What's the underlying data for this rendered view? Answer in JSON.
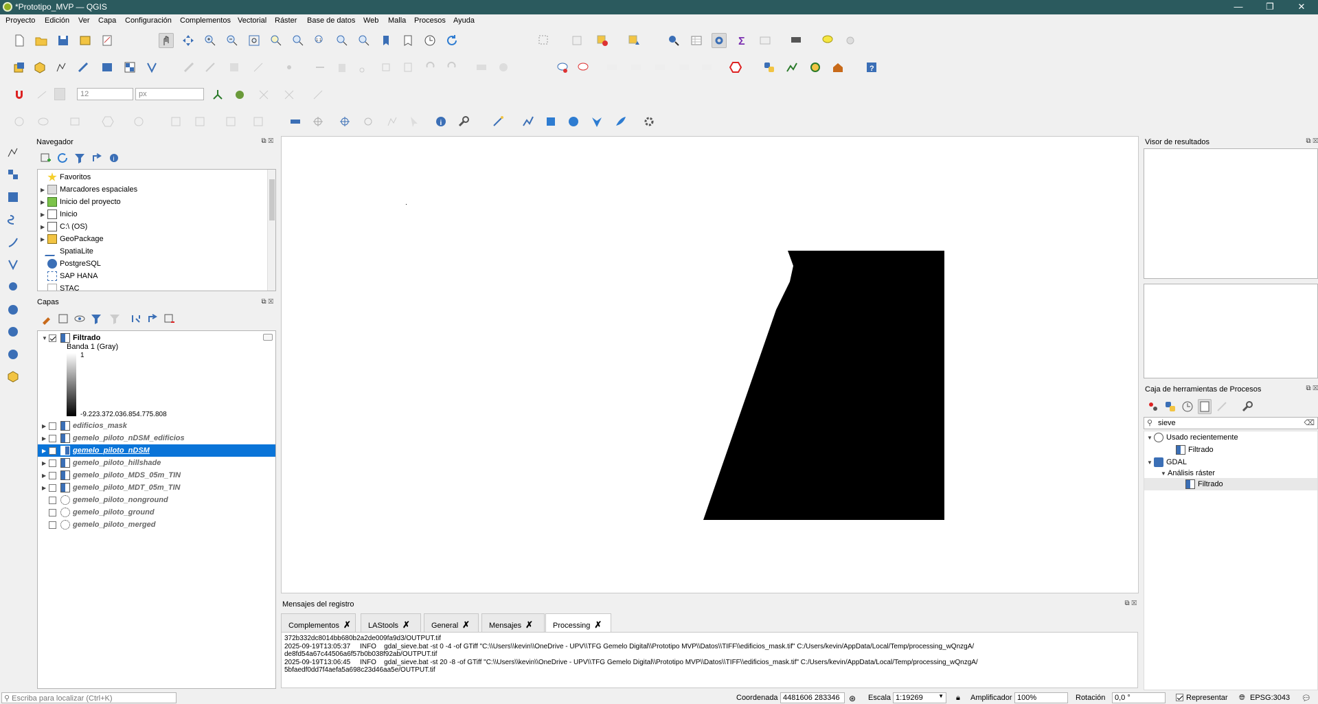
{
  "window": {
    "title": "*Prototipo_MVP — QGIS",
    "minimize": "—",
    "maximize": "❐",
    "close": "✕"
  },
  "menu": [
    "Proyecto",
    "Edición",
    "Ver",
    "Capa",
    "Configuración",
    "Complementos",
    "Vectorial",
    "Ráster",
    "Base de datos",
    "Web",
    "Malla",
    "Procesos",
    "Ayuda"
  ],
  "snapping": {
    "tolerance": "12",
    "unit": "px"
  },
  "browser": {
    "title": "Navegador",
    "items": [
      "Favoritos",
      "Marcadores espaciales",
      "Inicio del proyecto",
      "Inicio",
      "C:\\ (OS)",
      "GeoPackage",
      "SpatiaLite",
      "PostgreSQL",
      "SAP HANA",
      "STAC"
    ]
  },
  "layers": {
    "title": "Capas",
    "active": {
      "name": "Filtrado",
      "band": "Banda 1 (Gray)",
      "max": "1",
      "min": "-9.223.372.036.854.775.808"
    },
    "list": [
      "edificios_mask",
      "gemelo_piloto_nDSM_edificios",
      "gemelo_piloto_nDSM",
      "gemelo_piloto_hillshade",
      "gemelo_piloto_MDS_05m_TIN",
      "gemelo_piloto_MDT_05m_TIN",
      "gemelo_piloto_nonground",
      "gemelo_piloto_ground",
      "gemelo_piloto_merged"
    ],
    "selected": "gemelo_piloto_nDSM"
  },
  "results": {
    "title": "Visor de resultados"
  },
  "toolbox": {
    "title": "Caja de herramientas de Procesos",
    "search": "sieve",
    "recent_label": "Usado recientemente",
    "recent_item": "Filtrado",
    "provider": "GDAL",
    "group": "Análisis ráster",
    "algo": "Filtrado"
  },
  "log": {
    "title": "Mensajes del registro",
    "tabs": [
      "Complementos",
      "LAStools",
      "General",
      "Mensajes",
      "Processing"
    ],
    "active_tab": "Processing",
    "lines": [
      "372b332dc8014bb680b2a2de009fa9d3/OUTPUT.tif",
      "2025-09-19T13:05:37     INFO    gdal_sieve.bat -st 0 -4 -of GTiff \"C:\\\\Users\\\\kevin\\\\OneDrive - UPV\\\\TFG Gemelo Digital\\\\Prototipo MVP\\\\Datos\\\\TIFF\\\\edificios_mask.tif\" C:/Users/kevin/AppData/Local/Temp/processing_wQnzgA/",
      "de8fd54a67c44506a6f57b0b038f92ab/OUTPUT.tif",
      "2025-09-19T13:06:45     INFO    gdal_sieve.bat -st 20 -8 -of GTiff \"C:\\\\Users\\\\kevin\\\\OneDrive - UPV\\\\TFG Gemelo Digital\\\\Prototipo MVP\\\\Datos\\\\TIFF\\\\edificios_mask.tif\" C:/Users/kevin/AppData/Local/Temp/processing_wQnzgA/",
      "5bfaedf0dd7f4aefa5a698c23d46aa5e/OUTPUT.tif"
    ]
  },
  "status": {
    "locator_placeholder": "Escriba para localizar (Ctrl+K)",
    "coord_label": "Coordenada",
    "coord": "4481606  283346",
    "scale_label": "Escala",
    "scale": "1:19269",
    "magnifier_label": "Amplificador",
    "magnifier": "100%",
    "rotation_label": "Rotación",
    "rotation": "0,0 °",
    "render_label": "Representar",
    "crs": "EPSG:3043"
  }
}
